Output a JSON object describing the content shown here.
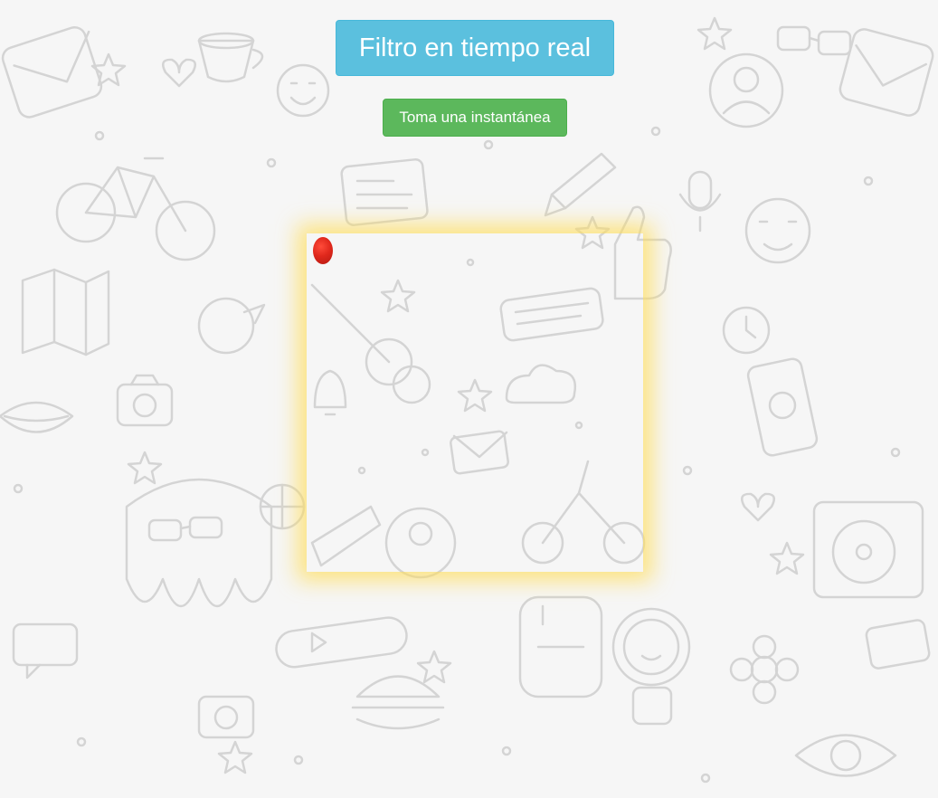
{
  "header": {
    "title_label": "Filtro en tiempo real"
  },
  "controls": {
    "snapshot_label": "Toma una instantánea"
  },
  "colors": {
    "title_button_bg": "#5bc0de",
    "snapshot_button_bg": "#5cb85c",
    "glow": "#ffdd5a",
    "background": "#f6f6f6",
    "doodle_stroke": "#d4d4d4",
    "marker": "#e0281c"
  },
  "icons": {
    "background": "doodle-pattern",
    "marker": "red-dot-marker"
  }
}
